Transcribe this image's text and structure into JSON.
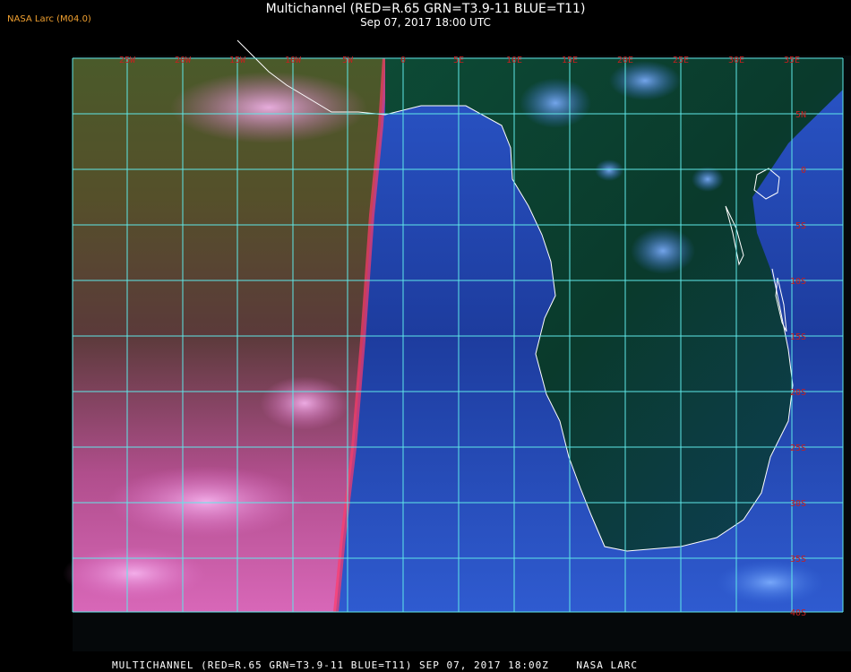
{
  "credit": "NASA Larc (M04.0)",
  "title": {
    "line1": "Multichannel (RED=R.65 GRN=T3.9-11 BLUE=T11)",
    "line2": "Sep 07, 2017 18:00 UTC"
  },
  "footer": "MULTICHANNEL (RED=R.65 GRN=T3.9-11 BLUE=T11) SEP 07, 2017 18:00Z    NASA LARC",
  "colors": {
    "grid": "#5fe8e8",
    "label": "#c81e1e",
    "coast": "#ffffff",
    "ocean_west": "#5a4a26",
    "ocean_east": "#1e3c98",
    "land": "#0a3a2a"
  },
  "map": {
    "lon_labels": [
      "25W",
      "20W",
      "15W",
      "10W",
      "5W",
      "0",
      "5E",
      "10E",
      "15E",
      "20E",
      "25E",
      "30E",
      "35E"
    ],
    "lat_labels": [
      "5N",
      "0",
      "5S",
      "10S",
      "15S",
      "20S",
      "25S",
      "30S",
      "35S",
      "40S"
    ]
  }
}
